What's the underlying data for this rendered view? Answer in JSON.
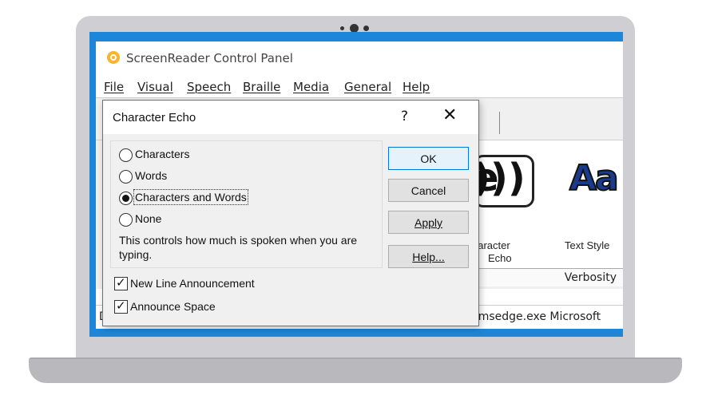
{
  "app": {
    "title": "ScreenReader Control Panel",
    "menu": [
      "File",
      "Visual",
      "Speech",
      "Braille",
      "Media",
      "General",
      "Help"
    ]
  },
  "panel": {
    "echo_label_line1": "haracter",
    "echo_label_line2": "Echo",
    "text_style_label": "Text Style",
    "verbosity": "Verbosity",
    "aa_glyph": "Aa",
    "echo_glyph": "e"
  },
  "status_bar": {
    "left": "D",
    "right": "\\msedge.exe Microsoft"
  },
  "dialog": {
    "title": "Character Echo",
    "help_glyph": "?",
    "close_glyph": "✕",
    "options": [
      {
        "label": "Characters",
        "selected": false
      },
      {
        "label": "Words",
        "selected": false
      },
      {
        "label": "Characters and Words",
        "selected": true
      },
      {
        "label": "None",
        "selected": false
      }
    ],
    "description": "This controls how much is spoken when you are typing.",
    "buttons": {
      "ok": "OK",
      "cancel": "Cancel",
      "apply": "Apply",
      "help": "Help..."
    },
    "checkboxes": [
      {
        "label": "New Line Announcement",
        "checked": true
      },
      {
        "label": "Announce Space",
        "checked": true
      }
    ]
  },
  "colors": {
    "desktop": "#1d86d8",
    "default_button_border": "#0078d7"
  }
}
